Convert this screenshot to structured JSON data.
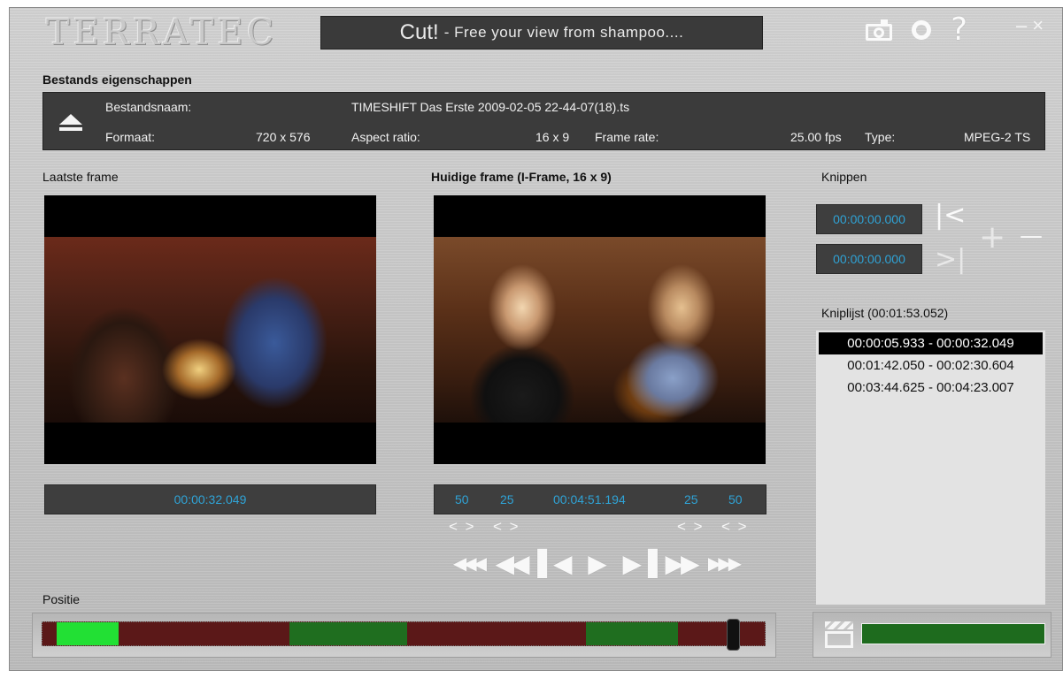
{
  "window": {
    "logo": "TERRATEC",
    "headline_big": "Cut!",
    "headline_small": "- Free your view from shampoo....",
    "minimize_glyph": "–",
    "close_glyph": "×"
  },
  "icons": {
    "snapshot": "camera-icon",
    "settings": "ring-icon",
    "help_glyph": "?"
  },
  "file_props": {
    "heading": "Bestands eigenschappen",
    "filename_label": "Bestandsnaam:",
    "filename_value": "TIMESHIFT Das Erste 2009-02-05 22-44-07(18).ts",
    "format_label": "Formaat:",
    "format_value": "720 x 576",
    "aspect_label": "Aspect ratio:",
    "aspect_value": "16 x 9",
    "framerate_label": "Frame rate:",
    "framerate_value": "25.00 fps",
    "type_label": "Type:",
    "type_value": "MPEG-2 TS"
  },
  "last_frame": {
    "heading": "Laatste frame",
    "time": "00:00:32.049"
  },
  "current_frame": {
    "heading": "Huidige frame (I-Frame, 16 x 9)",
    "step_left_far": "50",
    "step_left_near": "25",
    "time": "00:04:51.194",
    "step_right_near": "25",
    "step_right_far": "50",
    "arrow_glyph": "< >"
  },
  "transport": {
    "fast_rewind": "◀◀◀",
    "rewind": "◀◀",
    "step_back": "▌◀",
    "play": "▶",
    "step_forward": "▶▐",
    "forward": "▶▶",
    "fast_forward": "▶▶▶"
  },
  "cut": {
    "heading": "Knippen",
    "start_time": "00:00:00.000",
    "end_time": "00:00:00.000",
    "set_start_glyph": "|<",
    "set_end_glyph": ">|",
    "add_glyph": "+",
    "remove_glyph": "—",
    "list_heading": "Kniplijst (00:01:53.052)",
    "list": [
      "00:00:05.933 - 00:00:32.049",
      "00:01:42.050 - 00:02:30.604",
      "00:03:44.625 - 00:04:23.007"
    ],
    "selected_index": 0
  },
  "position": {
    "heading": "Positie",
    "handle_fraction": 0.965,
    "segments": [
      {
        "color": "#5b1818",
        "fraction": 0.02
      },
      {
        "color": "#22e034",
        "fraction": 0.085
      },
      {
        "color": "#5b1818",
        "fraction": 0.237
      },
      {
        "color": "#1f6e1f",
        "fraction": 0.163
      },
      {
        "color": "#5b1818",
        "fraction": 0.247
      },
      {
        "color": "#1f6e1f",
        "fraction": 0.128
      },
      {
        "color": "#5b1818",
        "fraction": 0.12
      }
    ]
  },
  "colors": {
    "time_text": "#2fa3d6",
    "panel_dark": "#3b3b3b",
    "progress_green": "#1e6b1e"
  },
  "export": {
    "progress": 1.0
  }
}
